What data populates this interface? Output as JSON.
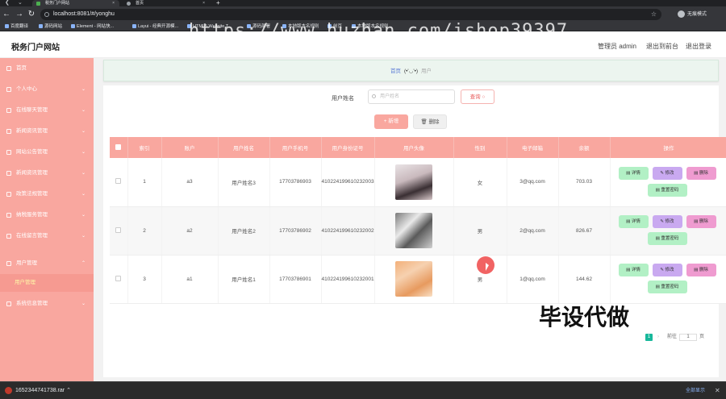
{
  "browser": {
    "tabs": [
      {
        "label": "税务门户网站",
        "active": true
      },
      {
        "label": "首页",
        "active": false
      }
    ],
    "new_tab": "+",
    "url": "localhost:8081/#/yonghu",
    "profile_label": "无痕模式",
    "bookmarks": [
      "百度翻译",
      "源码网站",
      "Element - 网站快...",
      "Layui - 经典开源模...",
      "HTML5 Website T...",
      "源码部署",
      "本地版本名规则",
      "前页",
      "本地版本名规则"
    ]
  },
  "watermark": "https://www.huzhan.com/ishop39397",
  "header": {
    "site_title": "税务门户网站",
    "user_label": "管理员 admin",
    "back_label": "退出到前台",
    "logout_label": "退出登录"
  },
  "sidebar": {
    "items": [
      {
        "label": "首页",
        "icon": "home-icon"
      },
      {
        "label": "个人中心",
        "icon": "user-icon",
        "chevron": true
      },
      {
        "label": "在线聊天管理",
        "icon": "chat-icon",
        "chevron": true
      },
      {
        "label": "新闻资讯管理",
        "icon": "news-icon",
        "chevron": true
      },
      {
        "label": "网站公告管理",
        "icon": "notice-icon",
        "chevron": true
      },
      {
        "label": "新闻资讯管理",
        "icon": "news-icon",
        "chevron": true
      },
      {
        "label": "政策法规管理",
        "icon": "policy-icon",
        "chevron": true
      },
      {
        "label": "纳税服务管理",
        "icon": "service-icon",
        "chevron": true
      },
      {
        "label": "在线留言管理",
        "icon": "message-icon",
        "chevron": true
      },
      {
        "label": "用户管理",
        "icon": "users-icon",
        "chevron": true
      },
      {
        "label": "系统信息管理",
        "icon": "settings-icon",
        "chevron": true
      }
    ],
    "active_sub": "用户管理"
  },
  "breadcrumb": {
    "home": "首页",
    "separator": "(•'◡'•)",
    "current": "用户"
  },
  "search": {
    "label": "用户姓名",
    "placeholder": "用户姓名",
    "query_button": "查询 ○"
  },
  "actions": {
    "add_label": "+ 新增",
    "delete_label": "🗑 删除"
  },
  "table": {
    "columns": [
      "",
      "索引",
      "账户",
      "用户姓名",
      "用户手机号",
      "用户身份证号",
      "用户头像",
      "性别",
      "电子邮箱",
      "余额",
      "操作"
    ],
    "rows": [
      {
        "index": "1",
        "account": "a3",
        "name": "用户姓名3",
        "phone": "17703786903",
        "id_card": "410224199610232003",
        "gender": "女",
        "email": "3@qq.com",
        "balance": "703.03"
      },
      {
        "index": "2",
        "account": "a2",
        "name": "用户姓名2",
        "phone": "17703786902",
        "id_card": "410224199610232002",
        "gender": "男",
        "email": "2@qq.com",
        "balance": "826.67"
      },
      {
        "index": "3",
        "account": "a1",
        "name": "用户姓名1",
        "phone": "17703786901",
        "id_card": "410224199610232001",
        "gender": "男",
        "email": "1@qq.com",
        "balance": "144.62"
      }
    ],
    "ops": {
      "detail": "▤ 详情",
      "edit": "✎ 修改",
      "delete": "▤ 删除",
      "reset": "▤ 重置密码"
    }
  },
  "pagination": {
    "current_page": "1",
    "next": "›",
    "goto_prefix": "前往",
    "goto_value": "1",
    "goto_suffix": "页"
  },
  "overlay_text": "毕设代做",
  "download": {
    "filename": "1652344741738.rar",
    "show_all": "全部显示",
    "close": "✕"
  },
  "colors": {
    "accent": "#f9a79f",
    "teal": "#18b89b"
  }
}
